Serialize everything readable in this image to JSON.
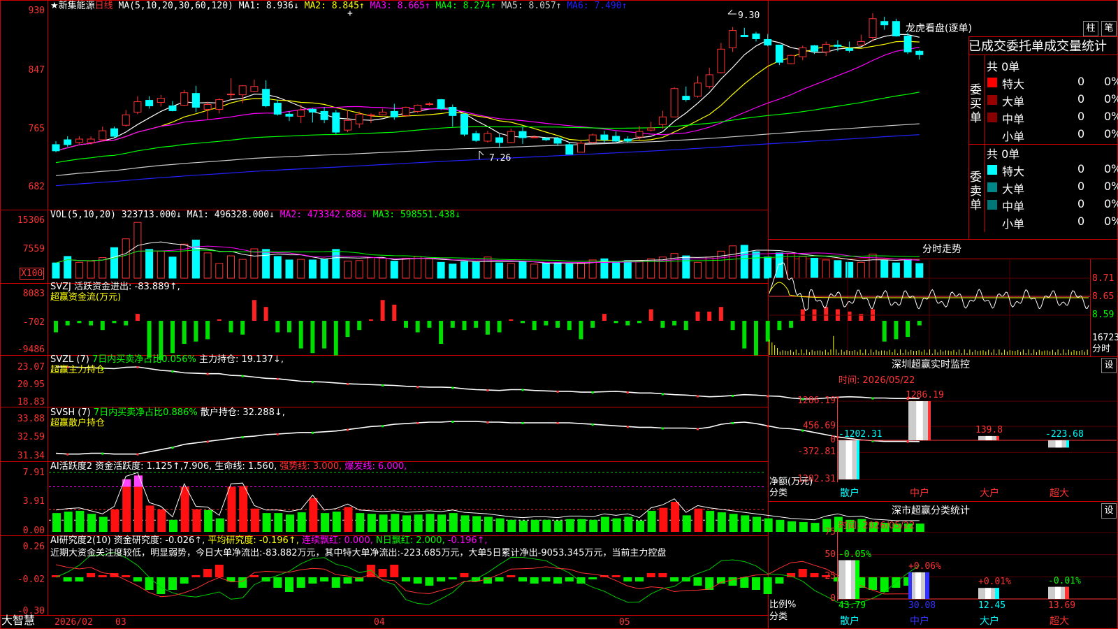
{
  "title_bar": {
    "stock_name": "★新集能源",
    "period": "日线",
    "ma_params": "MA(5,10,20,30,60,120)",
    "ma_values": [
      {
        "label": "MA1: 8.936↓",
        "color": "#ffffff"
      },
      {
        "label": "MA2: 8.845↑",
        "color": "#ffff00"
      },
      {
        "label": "MA3: 8.665↑",
        "color": "#ff00ff"
      },
      {
        "label": "MA4: 8.274↑",
        "color": "#00ff00"
      },
      {
        "label": "MA5: 8.057↑",
        "color": "#cccccc"
      },
      {
        "label": "MA6: 7.490↑",
        "color": "#2222ff"
      }
    ]
  },
  "panels": {
    "price": {
      "ticks": [
        "930",
        "847",
        "765",
        "682"
      ],
      "hi_label": "9.30",
      "lo_label": "7.26"
    },
    "volume": {
      "header": "VOL(5,10,20)",
      "value": "323713.000↓",
      "ma": [
        {
          "label": "MA1: 496328.000↓",
          "color": "#ffffff"
        },
        {
          "label": "MA2: 473342.688↓",
          "color": "#ff00ff"
        },
        {
          "label": "MA3: 598551.438↓",
          "color": "#00ff00"
        }
      ],
      "ticks": [
        "15306",
        "7559"
      ],
      "unit": "X100"
    },
    "svzj": {
      "line1": "SVZJ  活跃资金进出: -83.889↑,",
      "line2": "超赢资金流(万元)",
      "ticks": [
        "8083",
        "-702",
        "-9486"
      ]
    },
    "svzl": {
      "prefix": "SVZL (7) ",
      "net": "7日内买卖净占比0.056%",
      "hold": "主力持仓: 19.137↓,",
      "line2": "超赢主力持仓",
      "ticks": [
        "23.07",
        "20.95",
        "18.83"
      ]
    },
    "svsh": {
      "prefix": "SVSH (7) ",
      "net": "7日内买卖净占比0.886%",
      "hold": "散户持仓: 32.288↓,",
      "line2": "超赢散户持仓",
      "ticks": [
        "33.88",
        "32.59",
        "31.34"
      ]
    },
    "ai1": {
      "a": "AI活跃度2 资金活跃度: 1.125↑,7.906,",
      "b": "生命线: 1.560,",
      "c": "强势线: 3.000,",
      "d": "爆发线: 6.000,",
      "ticks": [
        "7.91",
        "3.91",
        "0.00"
      ]
    },
    "ai2": {
      "a": "AI研究度2(10) 资金研究度: -0.026↑,",
      "b": "平均研究度: -0.196↑,",
      "c": "连续飘红: 0.000,",
      "d": "N日飘红: 2.000,",
      "e": "-0.196↑,",
      "comment": "近期大资金关注度较低，明显弱势，今日大单净流出:-83.882万元，其中特大单净流出:-223.685万元，大单5日累计净出-9053.345万元，当前主力控盘",
      "ticks": [
        "0.26",
        "-0.02",
        "-0.30"
      ]
    }
  },
  "date_axis": {
    "brand": "大智慧",
    "labels": [
      "2026/02",
      "03",
      "04",
      "05"
    ]
  },
  "chart_data": {
    "type": "bar",
    "title": "★新集能源 日线",
    "ylim": [
      6.5,
      9.45
    ],
    "candles": [
      [
        7.4,
        7.31,
        7.45,
        7.29
      ],
      [
        7.47,
        7.4,
        7.52,
        7.37
      ],
      [
        7.43,
        7.48,
        7.52,
        7.41
      ],
      [
        7.43,
        7.48,
        7.52,
        7.4
      ],
      [
        7.47,
        7.6,
        7.66,
        7.45
      ],
      [
        7.63,
        7.52,
        7.66,
        7.49
      ],
      [
        7.68,
        7.83,
        7.9,
        7.66
      ],
      [
        7.87,
        8.02,
        8.1,
        7.84
      ],
      [
        8.04,
        7.96,
        8.1,
        7.92
      ],
      [
        8.01,
        8.07,
        8.12,
        7.95
      ],
      [
        7.96,
        7.89,
        8.03,
        7.88
      ],
      [
        7.97,
        8.15,
        8.19,
        7.96
      ],
      [
        8.14,
        7.94,
        8.25,
        7.87
      ],
      [
        7.91,
        7.98,
        8.02,
        7.76
      ],
      [
        7.91,
        8.05,
        8.07,
        7.85
      ],
      [
        8.13,
        8.13,
        8.36,
        8.05
      ],
      [
        8.12,
        8.25,
        8.26,
        8.0
      ],
      [
        8.17,
        8.24,
        8.34,
        8.16
      ],
      [
        8.2,
        7.96,
        8.33,
        7.94
      ],
      [
        8.0,
        7.84,
        8.05,
        7.82
      ],
      [
        7.84,
        7.81,
        7.88,
        7.74
      ],
      [
        7.81,
        7.9,
        7.98,
        7.71
      ],
      [
        7.91,
        7.87,
        7.93,
        7.72
      ],
      [
        7.88,
        7.76,
        7.94,
        7.71
      ],
      [
        7.86,
        7.58,
        7.9,
        7.55
      ],
      [
        7.61,
        7.75,
        7.9,
        7.58
      ],
      [
        7.7,
        7.84,
        7.88,
        7.64
      ],
      [
        7.82,
        7.83,
        7.85,
        7.71
      ],
      [
        7.83,
        7.87,
        7.92,
        7.82
      ],
      [
        7.88,
        7.8,
        7.99,
        7.76
      ],
      [
        7.82,
        7.94,
        7.95,
        7.8
      ],
      [
        7.88,
        7.97,
        7.98,
        7.86
      ],
      [
        7.98,
        7.99,
        8.01,
        7.96
      ],
      [
        8.05,
        7.92,
        8.06,
        7.9
      ],
      [
        7.94,
        7.82,
        7.98,
        7.66
      ],
      [
        7.84,
        7.55,
        7.86,
        7.52
      ],
      [
        7.56,
        7.46,
        7.6,
        7.44
      ],
      [
        7.45,
        7.56,
        7.6,
        7.43
      ],
      [
        7.5,
        7.43,
        7.55,
        7.36
      ],
      [
        7.43,
        7.59,
        7.63,
        7.42
      ],
      [
        7.59,
        7.5,
        7.66,
        7.41
      ],
      [
        7.5,
        7.51,
        7.53,
        7.5
      ],
      [
        7.49,
        7.47,
        7.5,
        7.45
      ],
      [
        7.49,
        7.42,
        7.51,
        7.38
      ],
      [
        7.4,
        7.26,
        7.43,
        7.26
      ],
      [
        7.29,
        7.42,
        7.45,
        7.29
      ],
      [
        7.43,
        7.54,
        7.56,
        7.42
      ],
      [
        7.54,
        7.47,
        7.6,
        7.43
      ],
      [
        7.52,
        7.45,
        7.59,
        7.44
      ],
      [
        7.48,
        7.45,
        7.52,
        7.43
      ],
      [
        7.51,
        7.59,
        7.67,
        7.46
      ],
      [
        7.61,
        7.64,
        7.73,
        7.59
      ],
      [
        7.69,
        7.8,
        7.89,
        7.63
      ],
      [
        7.8,
        8.21,
        8.23,
        7.8
      ],
      [
        8.1,
        8.05,
        8.24,
        8.02
      ],
      [
        8.1,
        8.29,
        8.39,
        8.08
      ],
      [
        8.24,
        8.41,
        8.51,
        8.21
      ],
      [
        8.44,
        8.78,
        8.87,
        8.43
      ],
      [
        8.8,
        9.05,
        9.1,
        8.74
      ],
      [
        8.98,
        8.96,
        9.09,
        8.96
      ],
      [
        9.0,
        8.93,
        9.03,
        8.89
      ],
      [
        8.92,
        8.84,
        9.0,
        8.82
      ],
      [
        8.84,
        8.59,
        8.84,
        8.55
      ],
      [
        8.57,
        8.69,
        8.7,
        8.56
      ],
      [
        8.67,
        8.8,
        8.83,
        8.62
      ],
      [
        8.83,
        8.75,
        8.84,
        8.71
      ],
      [
        8.74,
        8.85,
        8.89,
        8.68
      ],
      [
        8.84,
        8.82,
        8.91,
        8.75
      ],
      [
        8.79,
        8.76,
        8.89,
        8.73
      ],
      [
        8.84,
        8.89,
        8.99,
        8.83
      ],
      [
        8.95,
        9.22,
        9.3,
        8.89
      ],
      [
        9.18,
        9.13,
        9.25,
        9.06
      ],
      [
        9.18,
        8.97,
        9.22,
        8.96
      ],
      [
        8.97,
        8.74,
        9.02,
        8.71
      ],
      [
        8.75,
        8.7,
        8.77,
        8.63
      ]
    ],
    "volume": [
      2.6,
      3.7,
      2.7,
      2.9,
      3.5,
      5.2,
      6.7,
      9.5,
      4.9,
      4.6,
      3.6,
      5.8,
      6.5,
      4.3,
      2.5,
      3.8,
      3.2,
      5.0,
      4.9,
      3.7,
      3.1,
      3.2,
      3.1,
      3.2,
      4.9,
      2.9,
      3.0,
      3.5,
      3.4,
      2.9,
      3.4,
      3.7,
      3.3,
      2.7,
      2.4,
      2.8,
      2.8,
      3.6,
      2.6,
      2.5,
      2.8,
      2.4,
      2.5,
      2.6,
      2.4,
      2.6,
      3.1,
      3.3,
      2.8,
      3.0,
      2.9,
      3.3,
      3.6,
      4.2,
      3.8,
      2.7,
      3.6,
      4.6,
      5.5,
      5.6,
      4.5,
      3.6,
      4.3,
      4.2,
      3.7,
      3.4,
      3.1,
      3.0,
      2.7,
      2.7,
      4.1,
      3.1,
      2.6,
      3.2,
      2.5
    ],
    "svzj": [
      -0.5,
      -0.2,
      -0.1,
      -0.2,
      -0.4,
      -0.1,
      -0.2,
      0.3,
      -1.6,
      -1.7,
      -1.4,
      -1.0,
      -0.9,
      -0.8,
      0.0,
      -0.5,
      -0.6,
      0.9,
      0.6,
      -0.5,
      -0.5,
      -1.2,
      -1.4,
      -1.2,
      -1.5,
      -0.7,
      -0.4,
      0.0,
      0.9,
      0.7,
      -0.3,
      -0.5,
      -0.3,
      -1.0,
      -0.3,
      -0.4,
      -0.3,
      -0.6,
      -0.5,
      0.0,
      -0.1,
      -0.4,
      -0.2,
      -0.3,
      -0.4,
      -0.8,
      -0.3,
      0.3,
      -0.1,
      -0.2,
      -0.1,
      0.5,
      -0.3,
      -0.2,
      -0.4,
      0.4,
      0.4,
      0.6,
      -0.4,
      -1.2,
      -1.5,
      -0.9,
      -0.4,
      -0.3,
      0.5,
      0.5,
      0.6,
      0.5,
      0.4,
      0.3,
      0.5,
      -0.9,
      -0.8,
      -0.7,
      -0.2
    ],
    "svzl": [
      22.9,
      22.9,
      22.85,
      22.8,
      22.75,
      22.7,
      22.85,
      22.9,
      22.7,
      22.5,
      22.4,
      22.2,
      22.15,
      22.1,
      22.1,
      21.9,
      21.85,
      21.7,
      21.55,
      21.5,
      21.35,
      21.2,
      21.15,
      21.1,
      21.0,
      20.9,
      20.85,
      20.8,
      20.75,
      20.7,
      20.6,
      20.55,
      20.5,
      20.5,
      20.45,
      20.3,
      20.2,
      20.15,
      20.1,
      20.2,
      20.2,
      20.1,
      20.05,
      20.0,
      20.0,
      19.9,
      19.9,
      19.95,
      20.0,
      19.9,
      19.8,
      19.8,
      19.7,
      19.6,
      19.55,
      19.45,
      19.35,
      19.4,
      19.5,
      19.6,
      19.55,
      19.45,
      19.4,
      19.2,
      19.1,
      19.1,
      19.2,
      19.3,
      19.35,
      19.3,
      19.2,
      19.2,
      19.15,
      19.15,
      19.14
    ],
    "svsh": [
      31.5,
      31.45,
      31.45,
      31.5,
      31.5,
      31.45,
      31.45,
      31.45,
      31.6,
      31.75,
      31.9,
      32.1,
      32.2,
      32.3,
      32.4,
      32.5,
      32.6,
      32.65,
      32.75,
      32.8,
      32.85,
      32.9,
      32.9,
      32.95,
      33.0,
      33.1,
      33.2,
      33.3,
      33.35,
      33.45,
      33.5,
      33.55,
      33.6,
      33.6,
      33.65,
      33.65,
      33.65,
      33.6,
      33.6,
      33.55,
      33.55,
      33.55,
      33.55,
      33.55,
      33.55,
      33.5,
      33.45,
      33.4,
      33.35,
      33.3,
      33.25,
      33.25,
      33.2,
      33.2,
      33.2,
      33.15,
      33.25,
      33.45,
      33.55,
      33.6,
      33.5,
      33.35,
      33.2,
      33.15,
      33.05,
      32.9,
      32.75,
      32.6,
      32.5,
      32.4,
      32.35,
      32.3,
      32.3,
      32.3,
      32.29
    ],
    "ai1": [
      2.5,
      2.7,
      2.8,
      2.4,
      2.0,
      3.0,
      7.0,
      7.5,
      3.5,
      3.0,
      1.6,
      6.0,
      3.0,
      2.9,
      1.8,
      6.0,
      6.1,
      3.1,
      2.5,
      2.5,
      2.3,
      2.6,
      4.5,
      2.5,
      2.7,
      3.3,
      2.5,
      2.4,
      2.3,
      2.4,
      2.2,
      2.3,
      2.4,
      2.3,
      2.5,
      2.2,
      2.1,
      2.0,
      1.8,
      1.6,
      1.5,
      1.6,
      1.6,
      1.5,
      1.7,
      1.7,
      1.6,
      2.0,
      1.8,
      2.0,
      1.5,
      2.8,
      3.2,
      4.0,
      2.2,
      3.1,
      2.8,
      2.6,
      2.4,
      2.2,
      2.0,
      1.8,
      1.6,
      1.4,
      1.3,
      1.2,
      1.7,
      2.0,
      1.6,
      1.7,
      1.3,
      1.2,
      1.1,
      1.1,
      1.1
    ],
    "ai2": [
      0.0,
      -0.02,
      -0.02,
      0.02,
      0.0,
      0.02,
      0.0,
      -0.02,
      -0.06,
      -0.08,
      -0.06,
      -0.03,
      0.0,
      0.04,
      0.06,
      -0.02,
      -0.05,
      0.0,
      -0.02,
      -0.05,
      -0.07,
      -0.05,
      -0.03,
      -0.02,
      -0.05,
      -0.03,
      -0.02,
      0.06,
      0.04,
      0.06,
      -0.02,
      -0.03,
      -0.04,
      -0.02,
      -0.01,
      0.02,
      -0.02,
      -0.03,
      -0.02,
      0.0,
      -0.02,
      -0.03,
      -0.02,
      -0.03,
      -0.02,
      -0.03,
      -0.01,
      0.01,
      0.0,
      -0.02,
      -0.02,
      0.02,
      0.02,
      -0.02,
      -0.02,
      -0.04,
      -0.06,
      -0.03,
      -0.04,
      -0.05,
      -0.06,
      -0.08,
      -0.03,
      0.02,
      0.04,
      0.02,
      0.01,
      -0.02,
      -0.04,
      -0.05,
      -0.06,
      -0.07,
      -0.05,
      -0.04,
      -0.03
    ]
  },
  "side": {
    "dragon_title": "龙虎看盘(逐单)",
    "btn_zhu": "柱",
    "btn_bi": "笔",
    "table_header": "已成交委托单成交量统计",
    "buy_group": "委买单",
    "sell_group": "委卖单",
    "buy_total": "共 0单",
    "sell_total": "共 0单",
    "sizes": [
      "特大",
      "大单",
      "中单",
      "小单"
    ],
    "count": "0",
    "pct": "0%",
    "buy_colors": [
      "#ff0000",
      "#990000",
      "#880000",
      "#000000"
    ],
    "sell_colors": [
      "#00ffff",
      "#008888",
      "#007777",
      "#000000"
    ],
    "intraday_title": "分时走势",
    "intraday_ticks": [
      "8.71",
      "8.65",
      "8.59"
    ],
    "intraday_vol": "16723",
    "intraday_vol_unit": "分时",
    "monitor_title": "深圳超赢实时监控",
    "monitor_btn": "设",
    "date_label": "时间: 2026/05/22",
    "monitor_ticks": [
      "1286.19",
      "456.69",
      "0",
      "-372.81",
      "-1202.31"
    ],
    "monitor_values": [
      {
        "cat": "散户",
        "value": -1202.31,
        "label": "-1202.31"
      },
      {
        "cat": "中户",
        "value": 1286.19,
        "label": "1286.19"
      },
      {
        "cat": "大户",
        "value": 139.8,
        "label": "139.8"
      },
      {
        "cat": "超大",
        "value": -223.68,
        "label": "-223.68"
      }
    ],
    "monitor_ylabel": "净额(万元)",
    "monitor_xlabel": "分类",
    "class_title": "深市超赢分类统计",
    "class_btn": "设",
    "class_ticks": [
      "75",
      "50",
      "25",
      "0"
    ],
    "class_values": [
      {
        "cat": "散户",
        "value": 43.79,
        "label": "43.79",
        "delta": "-0.05%",
        "color": "#00ff00"
      },
      {
        "cat": "中户",
        "value": 30.08,
        "label": "30.08",
        "delta": "+0.06%",
        "color": "#3333ff"
      },
      {
        "cat": "大户",
        "value": 12.45,
        "label": "12.45",
        "delta": "+0.01%",
        "color": "#00ffff"
      },
      {
        "cat": "超大",
        "value": 13.69,
        "label": "13.69",
        "delta": "-0.01%",
        "color": "#ff3333"
      }
    ],
    "class_ylabel": "比例%",
    "class_xlabel": "分类"
  }
}
